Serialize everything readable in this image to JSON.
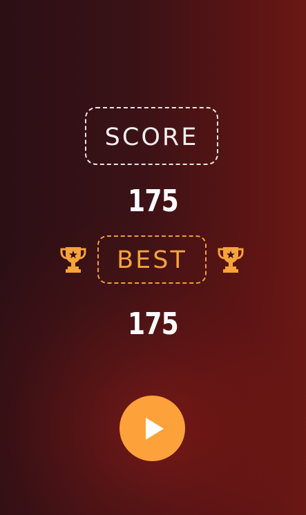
{
  "score": {
    "label": "SCORE",
    "value": "175"
  },
  "best": {
    "label": "BEST",
    "value": "175"
  },
  "icons": {
    "trophy": "trophy-icon",
    "play": "play-icon"
  },
  "colors": {
    "accent": "#fda13b",
    "best_label": "#f6a33c",
    "score_border": "#f2e8e8",
    "text": "#ffffff",
    "background_dark": "#2b0f15",
    "background_red": "#6a1814"
  }
}
